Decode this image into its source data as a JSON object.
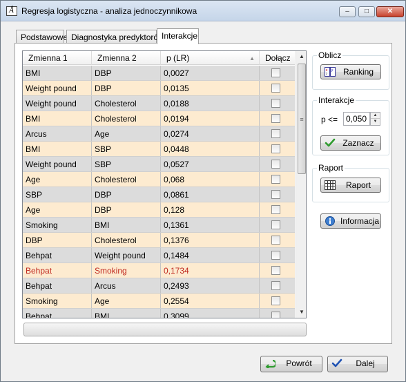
{
  "window": {
    "title": "Regresja logistyczna - analiza jednoczynnikowa",
    "minimize": "–",
    "maximize": "□",
    "close": "✕"
  },
  "tabs": [
    {
      "label": "Podstawowe"
    },
    {
      "label": "Diagnostyka predyktorów"
    },
    {
      "label": "Interakcje"
    }
  ],
  "table": {
    "headers": [
      "Zmienna 1",
      "Zmienna 2",
      "p (LR)",
      "Dołącz"
    ],
    "rows": [
      {
        "v1": "BMI",
        "v2": "DBP",
        "p": "0,0027"
      },
      {
        "v1": "Weight pound",
        "v2": "DBP",
        "p": "0,0135"
      },
      {
        "v1": "Weight pound",
        "v2": "Cholesterol",
        "p": "0,0188"
      },
      {
        "v1": "BMI",
        "v2": "Cholesterol",
        "p": "0,0194"
      },
      {
        "v1": "Arcus",
        "v2": "Age",
        "p": "0,0274"
      },
      {
        "v1": "BMI",
        "v2": "SBP",
        "p": "0,0448"
      },
      {
        "v1": "Weight pound",
        "v2": "SBP",
        "p": "0,0527"
      },
      {
        "v1": "Age",
        "v2": "Cholesterol",
        "p": "0,068"
      },
      {
        "v1": "SBP",
        "v2": "DBP",
        "p": "0,0861"
      },
      {
        "v1": "Age",
        "v2": "DBP",
        "p": "0,128"
      },
      {
        "v1": "Smoking",
        "v2": "BMI",
        "p": "0,1361"
      },
      {
        "v1": "DBP",
        "v2": "Cholesterol",
        "p": "0,1376"
      },
      {
        "v1": "Behpat",
        "v2": "Weight pound",
        "p": "0,1484"
      },
      {
        "v1": "Behpat",
        "v2": "Smoking",
        "p": "0,1734"
      },
      {
        "v1": "Behpat",
        "v2": "Arcus",
        "p": "0,2493"
      },
      {
        "v1": "Smoking",
        "v2": "Age",
        "p": "0,2554"
      },
      {
        "v1": "Behpat",
        "v2": "BMI",
        "p": "0,3099"
      }
    ],
    "highlighted_row": 13,
    "highlight_color": "#c0291f"
  },
  "groups": {
    "oblicz": {
      "title": "Oblicz",
      "button": "Ranking"
    },
    "interakcje": {
      "title": "Interakcje",
      "p_label": "p <=",
      "p_value": "0,050",
      "button": "Zaznacz"
    },
    "raport": {
      "title": "Raport",
      "button": "Raport"
    },
    "info_button": "Informacja"
  },
  "footer": {
    "back": "Powrót",
    "next": "Dalej"
  }
}
